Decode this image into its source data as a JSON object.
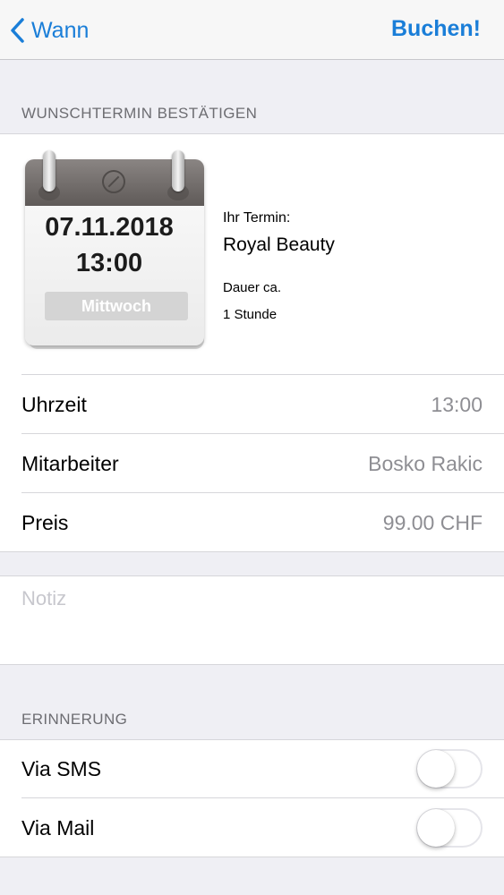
{
  "nav": {
    "back_label": "Wann",
    "action_label": "Buchen!"
  },
  "confirm_section": {
    "header": "WUNSCHTERMIN BESTÄTIGEN",
    "calendar": {
      "date": "07.11.2018",
      "time": "13:00",
      "weekday": "Mittwoch"
    },
    "appointment": {
      "label": "Ihr Termin:",
      "name": "Royal Beauty",
      "duration_label": "Dauer ca.",
      "duration_value": "1 Stunde"
    },
    "rows": [
      {
        "label": "Uhrzeit",
        "value": "13:00"
      },
      {
        "label": "Mitarbeiter",
        "value": "Bosko Rakic"
      },
      {
        "label": "Preis",
        "value": "99.00 CHF"
      }
    ]
  },
  "note": {
    "placeholder": "Notiz"
  },
  "reminder_section": {
    "header": "ERINNERUNG",
    "options": [
      {
        "label": "Via SMS",
        "enabled": false
      },
      {
        "label": "Via Mail",
        "enabled": false
      }
    ]
  },
  "colors": {
    "accent": "#1a7ed8",
    "background": "#efeff4",
    "secondary_text": "#8e8e93"
  },
  "icons": {
    "back": "chevron-left-icon",
    "calendar": "calendar-icon"
  }
}
